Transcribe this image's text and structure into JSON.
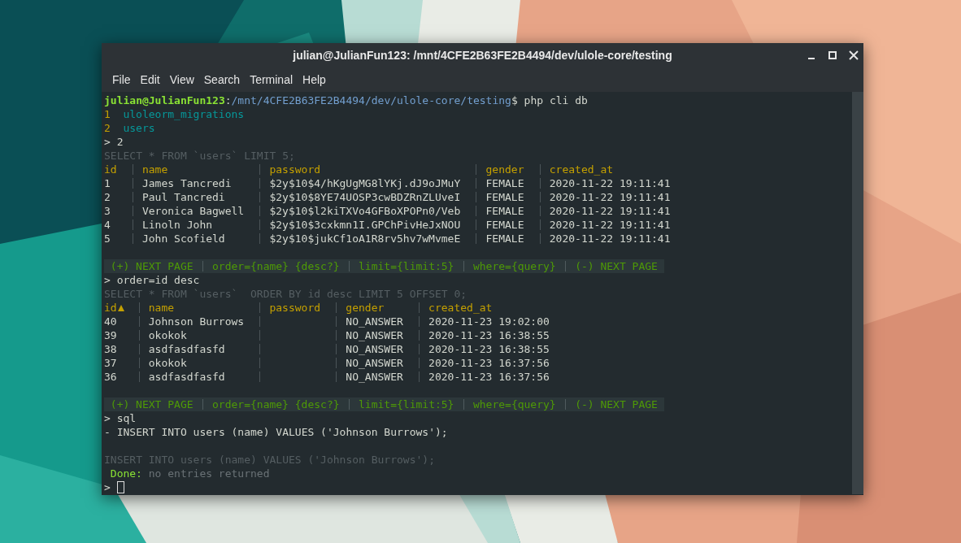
{
  "window": {
    "title": "julian@JulianFun123: /mnt/4CFE2B63FE2B4494/dev/ulole-core/testing"
  },
  "menu": [
    "File",
    "Edit",
    "View",
    "Search",
    "Terminal",
    "Help"
  ],
  "terminal": {
    "lines": [
      {
        "kind": "prompt",
        "user": "julian@JulianFun123",
        "separator": ":",
        "path": "/mnt/4CFE2B63FE2B4494/dev/ulole-core/testing",
        "command": "$ php cli db"
      },
      {
        "kind": "list_item",
        "number": "1",
        "text": "uloleorm_migrations"
      },
      {
        "kind": "list_item",
        "number": "2",
        "text": "users"
      },
      {
        "kind": "input",
        "text": "> 2"
      },
      {
        "kind": "query",
        "text": "SELECT * FROM `users` LIMIT 5;"
      },
      {
        "kind": "table",
        "columns": [
          {
            "label": "id",
            "sorted": false
          },
          {
            "label": "name",
            "sorted": false
          },
          {
            "label": "password",
            "sorted": false
          },
          {
            "label": "gender",
            "sorted": false
          },
          {
            "label": "created_at",
            "sorted": false
          }
        ],
        "rows": [
          [
            "1",
            "James Tancredi",
            "$2y$10$4/hKgUgMG8lYKj.dJ9oJMuY",
            "FEMALE",
            "2020-11-22 19:11:41"
          ],
          [
            "2",
            "Paul Tancredi",
            "$2y$10$8YE74UOSP3cwBDZRnZLUveI",
            "FEMALE",
            "2020-11-22 19:11:41"
          ],
          [
            "3",
            "Veronica Bagwell",
            "$2y$10$l2kiTXVo4GFBoXPOPn0/Veb",
            "FEMALE",
            "2020-11-22 19:11:41"
          ],
          [
            "4",
            "Linoln John",
            "$2y$10$3cxkmn1I.GPChPivHeJxNOU",
            "FEMALE",
            "2020-11-22 19:11:41"
          ],
          [
            "5",
            "John Scofield",
            "$2y$10$jukCf1oA1R8rv5hv7wMvmeE",
            "FEMALE",
            "2020-11-22 19:11:41"
          ]
        ]
      },
      {
        "kind": "blank"
      },
      {
        "kind": "hint_bar",
        "items": [
          "(+) NEXT PAGE",
          "order={name} {desc?}",
          "limit={limit:5}",
          "where={query}",
          "(-) NEXT PAGE"
        ]
      },
      {
        "kind": "input",
        "text": "> order=id desc"
      },
      {
        "kind": "query",
        "text": "SELECT * FROM `users`  ORDER BY id desc LIMIT 5 OFFSET 0;"
      },
      {
        "kind": "table",
        "columns": [
          {
            "label": "id",
            "sorted": true
          },
          {
            "label": "name",
            "sorted": false
          },
          {
            "label": "password",
            "sorted": false
          },
          {
            "label": "gender",
            "sorted": false
          },
          {
            "label": "created_at",
            "sorted": false
          }
        ],
        "rows": [
          [
            "40",
            "Johnson Burrows",
            null,
            "NO_ANSWER",
            "2020-11-23 19:02:00"
          ],
          [
            "39",
            "okokok",
            null,
            "NO_ANSWER",
            "2020-11-23 16:38:55"
          ],
          [
            "38",
            "asdfasdfasfd",
            null,
            "NO_ANSWER",
            "2020-11-23 16:38:55"
          ],
          [
            "37",
            "okokok",
            null,
            "NO_ANSWER",
            "2020-11-23 16:37:56"
          ],
          [
            "36",
            "asdfasdfasfd",
            null,
            "NO_ANSWER",
            "2020-11-23 16:37:56"
          ]
        ]
      },
      {
        "kind": "blank"
      },
      {
        "kind": "hint_bar",
        "items": [
          "(+) NEXT PAGE",
          "order={name} {desc?}",
          "limit={limit:5}",
          "where={query}",
          "(-) NEXT PAGE"
        ]
      },
      {
        "kind": "input",
        "text": "> sql"
      },
      {
        "kind": "input",
        "text": "- INSERT INTO users (name) VALUES ('Johnson Burrows');"
      },
      {
        "kind": "blank"
      },
      {
        "kind": "query",
        "text": "INSERT INTO users (name) VALUES ('Johnson Burrows');"
      },
      {
        "kind": "status",
        "label": "Done:",
        "message": "no entries returned"
      },
      {
        "kind": "input",
        "text": ">",
        "cursor": true
      }
    ]
  }
}
